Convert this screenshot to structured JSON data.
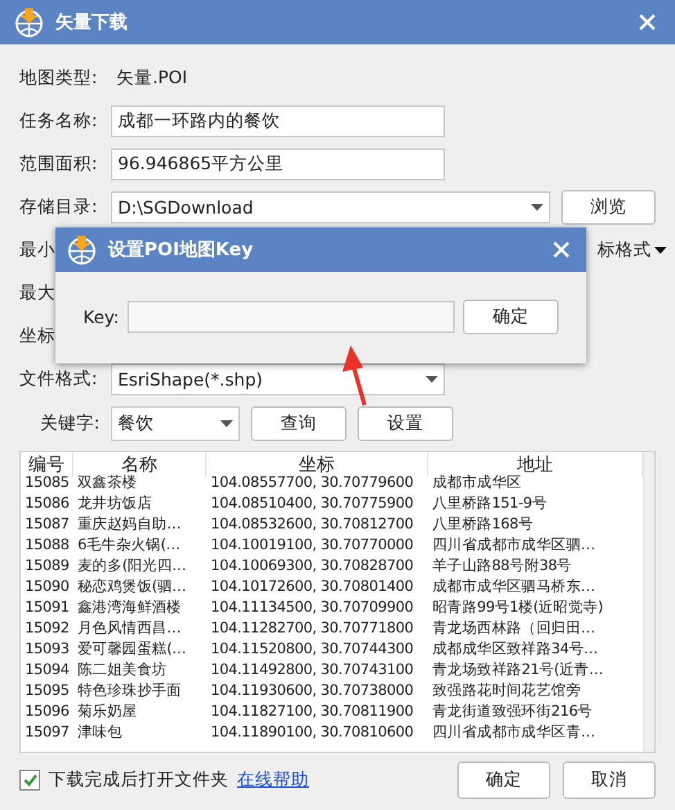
{
  "window": {
    "title": "矢量下载"
  },
  "fields": [
    {
      "kind": "static",
      "label": "地图类型:",
      "value": "矢量.POI"
    },
    {
      "kind": "text",
      "label": "任务名称:",
      "value": "成都一环路内的餐饮"
    },
    {
      "kind": "text",
      "label": "范围面积:",
      "value": "96.946865平方公里"
    },
    {
      "kind": "dropdown",
      "label": "存储目录:",
      "value": "D:\\SGDownload",
      "button": "浏览"
    },
    {
      "kind": "covered",
      "label": "最小",
      "right": "标格式"
    },
    {
      "kind": "covered",
      "label": "最大"
    },
    {
      "kind": "covered",
      "label": "坐标"
    },
    {
      "kind": "dropdown",
      "label": "文件格式:",
      "value": "EsriShape(*.shp)"
    }
  ],
  "keyword": {
    "label": "关键字:",
    "value": "餐饮",
    "buttons": [
      "查询",
      "设置"
    ]
  },
  "table": {
    "columns": [
      "编号",
      "名称",
      "坐标",
      "地址"
    ],
    "rows": [
      [
        "15085",
        "双鑫茶楼",
        "104.08557700, 30.70779600",
        "成都市成华区"
      ],
      [
        "15086",
        "龙井坊饭店",
        "104.08510400, 30.70775900",
        "八里桥路151-9号"
      ],
      [
        "15087",
        "重庆赵妈自助…",
        "104.08532600, 30.70812700",
        "八里桥路168号"
      ],
      [
        "15088",
        "6毛牛杂火锅(…",
        "104.10019100, 30.70770000",
        "四川省成都市成华区驷…"
      ],
      [
        "15089",
        "麦的多(阳光四…",
        "104.10069300, 30.70828700",
        "羊子山路88号附38号"
      ],
      [
        "15090",
        "秘恋鸡煲饭(驷…",
        "104.10172600, 30.70801400",
        "成都市成华区驷马桥东…"
      ],
      [
        "15091",
        "鑫港湾海鲜酒楼",
        "104.11134500, 30.70709900",
        "昭青路99号1楼(近昭觉寺)"
      ],
      [
        "15092",
        "月色风情西昌…",
        "104.11282700, 30.70771800",
        "青龙场西林路（回归田…"
      ],
      [
        "15093",
        "爱可馨园蛋糕(…",
        "104.11520800, 30.70744300",
        "成都成华区致祥路34号…"
      ],
      [
        "15094",
        "陈二姐美食坊",
        "104.11492800, 30.70743100",
        "青龙场致祥路21号(近青…"
      ],
      [
        "15095",
        "特色珍珠抄手面",
        "104.11930600, 30.70738000",
        "致强路花时间花艺馆旁"
      ],
      [
        "15096",
        "菊乐奶屋",
        "104.11827100, 30.70811900",
        "青龙街道致强环街216号"
      ],
      [
        "15097",
        "津味包",
        "104.11890100, 30.70810600",
        "四川省成都市成华区青…"
      ]
    ]
  },
  "footer": {
    "open_folder": {
      "label": "下载完成后打开文件夹",
      "checked": true
    },
    "help_link": "在线帮助",
    "buttons": [
      "确定",
      "取消"
    ]
  },
  "dialog": {
    "title": "设置POI地图Key",
    "label": "Key:",
    "button": "确定"
  }
}
